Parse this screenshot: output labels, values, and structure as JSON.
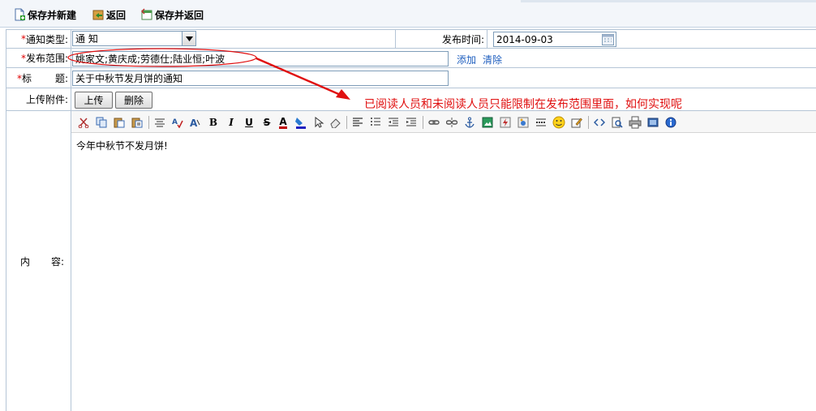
{
  "toolbar": {
    "save_new": "保存并新建",
    "back": "返回",
    "save_back": "保存并返回"
  },
  "form": {
    "type_label": "通知类型:",
    "type_value": "通 知",
    "date_label": "发布时间:",
    "date_value": "2014-09-03",
    "scope_label": "发布范围:",
    "scope_value": "姚家文;黄庆成;劳德仕;陆业恒;叶波",
    "add_link": "添加",
    "clear_link": "清除",
    "title_label_1": "标",
    "title_label_2": "题:",
    "title_value": "关于中秋节发月饼的通知",
    "attach_label": "上传附件:",
    "upload_btn": "上传",
    "delete_btn": "删除",
    "content_label_1": "内",
    "content_label_2": "容:",
    "content_text": "今年中秋节不发月饼!",
    "required_mark": "*"
  },
  "annotation": {
    "text": "已阅读人员和未阅读人员只能限制在发布范围里面，如何实现呢",
    "color": "#e01010"
  },
  "editor_icons": [
    "cut-icon",
    "copy-icon",
    "paste-icon",
    "paste-text-icon",
    "format-icon",
    "spellcheck-icon",
    "font-icon",
    "bold-icon",
    "italic-icon",
    "underline-icon",
    "strike-icon",
    "font-color-icon",
    "bg-color-icon",
    "select-icon",
    "eraser-icon",
    "align-left-icon",
    "list-icon",
    "outdent-icon",
    "indent-icon",
    "link-icon",
    "unlink-icon",
    "anchor-icon",
    "image-icon",
    "flash-icon",
    "media-icon",
    "hr-icon",
    "smiley-icon",
    "edit-icon",
    "source-icon",
    "preview-icon",
    "print-icon",
    "fullscreen-icon",
    "about-icon"
  ],
  "editor_glyphs": {
    "bold": "B",
    "italic": "I",
    "underline": "U",
    "strike": "S",
    "font_color": "A"
  }
}
